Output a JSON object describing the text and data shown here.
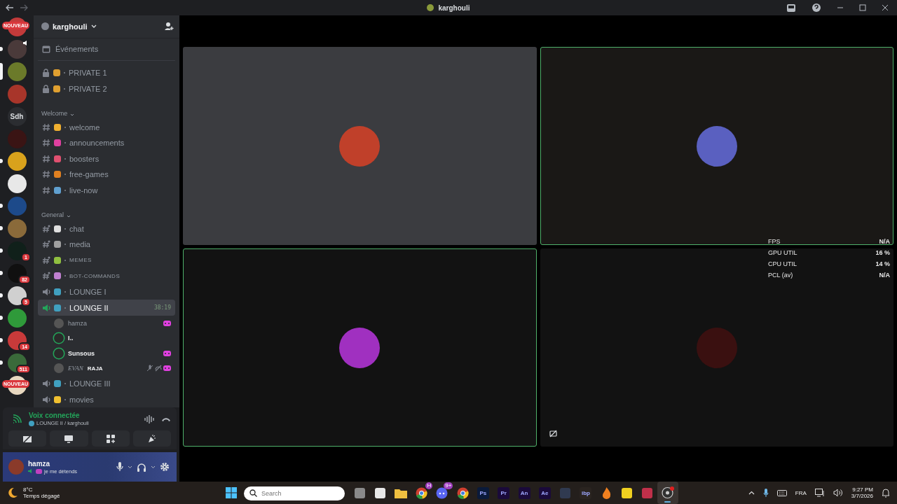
{
  "window": {
    "title": "karghouli"
  },
  "servers": [
    {
      "color": "#c23a3a",
      "unread": false,
      "selected": false,
      "tag": "NOUVEAU",
      "speaker": false
    },
    {
      "color": "#4a3a3a",
      "unread": true,
      "selected": false,
      "speaker": true
    },
    {
      "color": "#6b7a2a",
      "unread": false,
      "selected": true,
      "speaker": false
    },
    {
      "color": "#a8352a",
      "unread": false,
      "selected": false,
      "speaker": false
    },
    {
      "color": "#2b2d31",
      "unread": false,
      "selected": false,
      "label": "Sdh",
      "speaker": false
    },
    {
      "color": "#3a1414",
      "unread": false,
      "selected": false,
      "speaker": false
    },
    {
      "color": "#d9a21c",
      "unread": true,
      "selected": false,
      "speaker": false
    },
    {
      "color": "#e8e8e8",
      "unread": false,
      "selected": false,
      "speaker": false
    },
    {
      "color": "#1d4a8a",
      "unread": true,
      "selected": false,
      "speaker": false
    },
    {
      "color": "#8a6a3a",
      "unread": true,
      "selected": false,
      "speaker": false
    },
    {
      "color": "#10201a",
      "unread": true,
      "selected": false,
      "badge": "1",
      "speaker": false
    },
    {
      "color": "#101010",
      "unread": true,
      "selected": false,
      "badge": "82",
      "speaker": false
    },
    {
      "color": "#d0d0d0",
      "unread": true,
      "selected": false,
      "badge": "5",
      "speaker": false
    },
    {
      "color": "#2f9a3a",
      "unread": true,
      "selected": false,
      "speaker": false
    },
    {
      "color": "#c83a3a",
      "unread": true,
      "selected": false,
      "badge": "14",
      "speaker": false
    },
    {
      "color": "#3a6a3a",
      "unread": true,
      "selected": false,
      "badge": "511",
      "speaker": false
    },
    {
      "color": "#e8d8c0",
      "unread": false,
      "selected": false,
      "tag": "NOUVEAU",
      "speaker": false
    }
  ],
  "channel_panel": {
    "server_name": "karghouli",
    "events": "Événements",
    "groups": [
      {
        "channels": [
          {
            "kind": "locked",
            "color": "#e0a030",
            "name": "PRIVATE 1",
            "selected": false
          },
          {
            "kind": "locked",
            "color": "#e0a030",
            "name": "PRIVATE 2",
            "selected": false
          }
        ]
      },
      {
        "category": "Welcome",
        "channels": [
          {
            "kind": "text",
            "color": "#f0b030",
            "name": "welcome",
            "selected": false
          },
          {
            "kind": "text",
            "color": "#e040a0",
            "name": "announcements",
            "selected": false
          },
          {
            "kind": "text",
            "color": "#e05070",
            "name": "boosters",
            "selected": false
          },
          {
            "kind": "text",
            "color": "#e08020",
            "name": "free-games",
            "selected": false
          },
          {
            "kind": "text",
            "color": "#60a0d0",
            "name": "live-now",
            "selected": false
          }
        ]
      },
      {
        "category": "General",
        "channels": [
          {
            "kind": "thread",
            "color": "#e0e0e0",
            "name": "chat",
            "selected": false
          },
          {
            "kind": "thread",
            "color": "#a0a0a0",
            "name": "media",
            "selected": false
          },
          {
            "kind": "thread",
            "color": "#90c040",
            "name": "MEMES",
            "selected": false,
            "small_caps": true
          },
          {
            "kind": "thread",
            "color": "#c080d0",
            "name": "BOT-COMMANDS",
            "selected": false,
            "small_caps": true
          },
          {
            "kind": "voice",
            "color": "#40a0c0",
            "name": "LOUNGE I",
            "selected": false
          },
          {
            "kind": "voice",
            "color": "#40a0c0",
            "name": "LOUNGE II",
            "selected": true,
            "timer": "38:19",
            "members": [
              {
                "name": "hamza",
                "bold": false,
                "italic": false,
                "speaking": false,
                "activity": true,
                "muted": false,
                "deafened": false
              },
              {
                "name": "I..",
                "bold": true,
                "italic": false,
                "speaking": true,
                "activity": false,
                "muted": false,
                "deafened": false
              },
              {
                "name": "Sunsous",
                "bold": true,
                "italic": false,
                "speaking": true,
                "activity": true,
                "muted": false,
                "deafened": false
              },
              {
                "name": "EVAN",
                "tag": "RAJA",
                "bold": false,
                "italic": true,
                "speaking": false,
                "activity": true,
                "muted": true,
                "deafened": true
              }
            ]
          },
          {
            "kind": "voice",
            "color": "#40a0c0",
            "name": "LOUNGE III",
            "selected": false
          },
          {
            "kind": "voice",
            "color": "#f0c030",
            "name": "movies",
            "selected": false
          }
        ]
      }
    ]
  },
  "voice_panel": {
    "status": "Voix connectée",
    "channel": "LOUNGE II / karghouli"
  },
  "user_panel": {
    "name": "hamza",
    "status": "je me détends"
  },
  "tiles": [
    {
      "speaking": false,
      "muted_stream": false
    },
    {
      "speaking": true,
      "muted_stream": false
    },
    {
      "speaking": true,
      "muted_stream": false
    },
    {
      "speaking": false,
      "muted_stream": true
    }
  ],
  "overlay": [
    {
      "label": "FPS",
      "value": "N/A"
    },
    {
      "label": "GPU UTIL",
      "value": "16 %"
    },
    {
      "label": "CPU UTIL",
      "value": "14 %"
    },
    {
      "label": "PCL (av)",
      "value": "N/A"
    }
  ],
  "taskbar": {
    "weather_temp": "8°C",
    "weather_text": "Temps dégagé",
    "search_placeholder": "Search",
    "apps": [
      {
        "kind": "tile",
        "color": "#8a8a8a",
        "active": false
      },
      {
        "kind": "tile",
        "color": "#e8e8e8",
        "active": false
      },
      {
        "kind": "folder",
        "color": "#f0c040",
        "active": false
      },
      {
        "kind": "chrome",
        "color": "#d04030",
        "badge": "H",
        "active": false
      },
      {
        "kind": "discord",
        "color": "#5865f2",
        "badge": "9+",
        "active": false
      },
      {
        "kind": "chrome",
        "color": "#d04030",
        "active": false
      },
      {
        "kind": "adobe",
        "color": "#0a1a3a",
        "label": "Ps",
        "active": false
      },
      {
        "kind": "adobe",
        "color": "#1a0a3a",
        "label": "Pr",
        "active": false
      },
      {
        "kind": "adobe",
        "color": "#1a0a3a",
        "label": "An",
        "active": false
      },
      {
        "kind": "adobe",
        "color": "#1a0a3a",
        "label": "Ae",
        "active": false
      },
      {
        "kind": "tile",
        "color": "#303a50",
        "active": false
      },
      {
        "kind": "adobe",
        "color": "#2a2420",
        "label": "ibp",
        "active": false
      },
      {
        "kind": "flame",
        "color": "#f08020",
        "active": false
      },
      {
        "kind": "tile",
        "color": "#f0d020",
        "active": false
      },
      {
        "kind": "tile",
        "color": "#c0304a",
        "active": false
      },
      {
        "kind": "obs",
        "color": "#303030",
        "active": true
      }
    ],
    "lang": "FRA",
    "time": "9:27 PM",
    "date": "3/7/2026"
  }
}
